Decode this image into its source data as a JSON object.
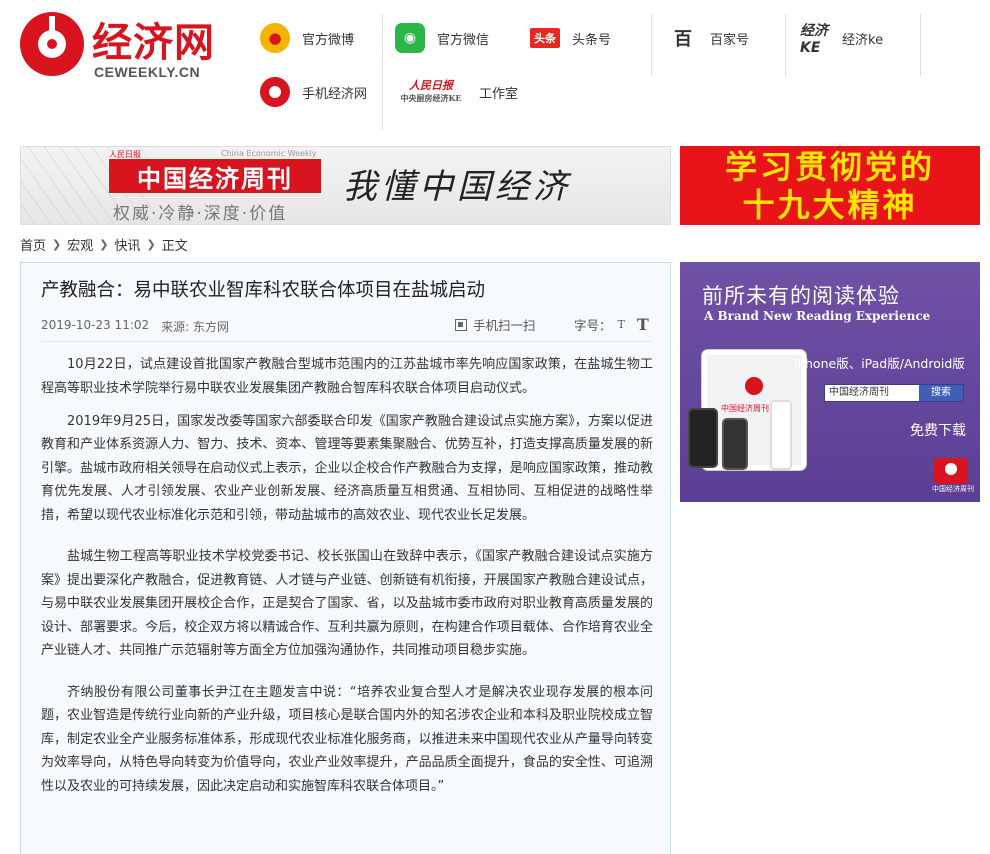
{
  "header": {
    "logo_text": "经济网",
    "logo_sub": "CEWEEKLY.CN",
    "links": [
      {
        "label": "官方微博",
        "icon": "weibo-icon"
      },
      {
        "label": "官方微信",
        "icon": "weixin-icon"
      },
      {
        "label": "头条号",
        "icon": "toutiao-icon",
        "icon_text": "头条"
      },
      {
        "label": "百家号",
        "icon": "baijiahao-icon",
        "icon_text": "百"
      },
      {
        "label": "经济ke",
        "icon": "jingjike-icon",
        "icon_text": "经济KE"
      },
      {
        "label": "手机经济网",
        "icon": "mobile-icon"
      },
      {
        "label": "工作室",
        "icon": "rmrb-icon",
        "icon_text": "人民日报",
        "icon_sub": "中央厨房经济KE"
      }
    ]
  },
  "banner_left": {
    "title": "中国经济周刊",
    "small_tag": "人民日报",
    "small_en": "China Economic Weekly",
    "tagline": "权威·冷静·深度·价值",
    "calligraphy": "我懂中国经济"
  },
  "banner_right": {
    "line1": "学习贯彻党的",
    "line2": "十九大精神"
  },
  "breadcrumb": [
    "首页",
    "宏观",
    "快讯",
    "正文"
  ],
  "article": {
    "title": "产教融合：易中联农业智库科农联合体项目在盐城启动",
    "date": "2019-10-23 11:02",
    "source": "来源: 东方网",
    "scan_label": "手机扫一扫",
    "font_label": "字号：",
    "font_small": "T",
    "font_big": "T",
    "paragraphs": [
      "10月22日，试点建设首批国家产教融合型城市范围内的江苏盐城市率先响应国家政策，在盐城生物工程高等职业技术学院举行易中联农业发展集团产教融合智库科农联合体项目启动仪式。",
      "2019年9月25日，国家发改委等国家六部委联合印发《国家产教融合建设试点实施方案》，方案以促进教育和产业体系资源人力、智力、技术、资本、管理等要素集聚融合、优势互补，打造支撑高质量发展的新引擎。盐城市政府相关领导在启动仪式上表示，企业以企校合作产教融合为支撑，是响应国家政策，推动教育优先发展、人才引领发展、农业产业创新发展、经济高质量互相贯通、互相协同、互相促进的战略性举措，希望以现代农业标准化示范和引领，带动盐城市的高效农业、现代农业长足发展。",
      "盐城生物工程高等职业技术学校党委书记、校长张国山在致辞中表示，《国家产教融合建设试点实施方案》提出要深化产教融合，促进教育链、人才链与产业链、创新链有机衔接，开展国家产教融合建设试点，与易中联农业发展集团开展校企合作，正是契合了国家、省，以及盐城市委市政府对职业教育高质量发展的设计、部署要求。今后，校企双方将以精诚合作、互利共赢为原则，在构建合作项目载体、合作培育农业全产业链人才、共同推广示范辐射等方面全方位加强沟通协作，共同推动项目稳步实施。",
      "齐纳股份有限公司董事长尹江在主题发言中说：“培养农业复合型人才是解决农业现存发展的根本问题，农业智造是传统行业向新的产业升级，项目核心是联合国内外的知名涉农企业和本科及职业院校成立智库，制定农业全产业服务标准体系，形成现代农业标准化服务商，以推进未来中国现代农业从产量导向转变为效率导向，从特色导向转变为价值导向，农业产业效率提升，产品品质全面提升，食品的安全性、可追溯性以及农业的可持续发展，因此决定启动和实施智库科农联合体项目。”"
    ]
  },
  "ad": {
    "headline": "前所未有的阅读体验",
    "subline": "A Brand New Reading Experience",
    "platforms": "iPhone版、iPad版/Android版",
    "search_value": "中国经济周刊",
    "search_button": "搜索",
    "download": "免费下载",
    "tablet_text": "中国经济周刊",
    "app_name": "中国经济周刊"
  },
  "colors": {
    "brand_red": "#d8141e",
    "banner_yellow": "#ffe400",
    "ad_purple": "#5a3f94",
    "article_bg": "#f7fafc"
  }
}
